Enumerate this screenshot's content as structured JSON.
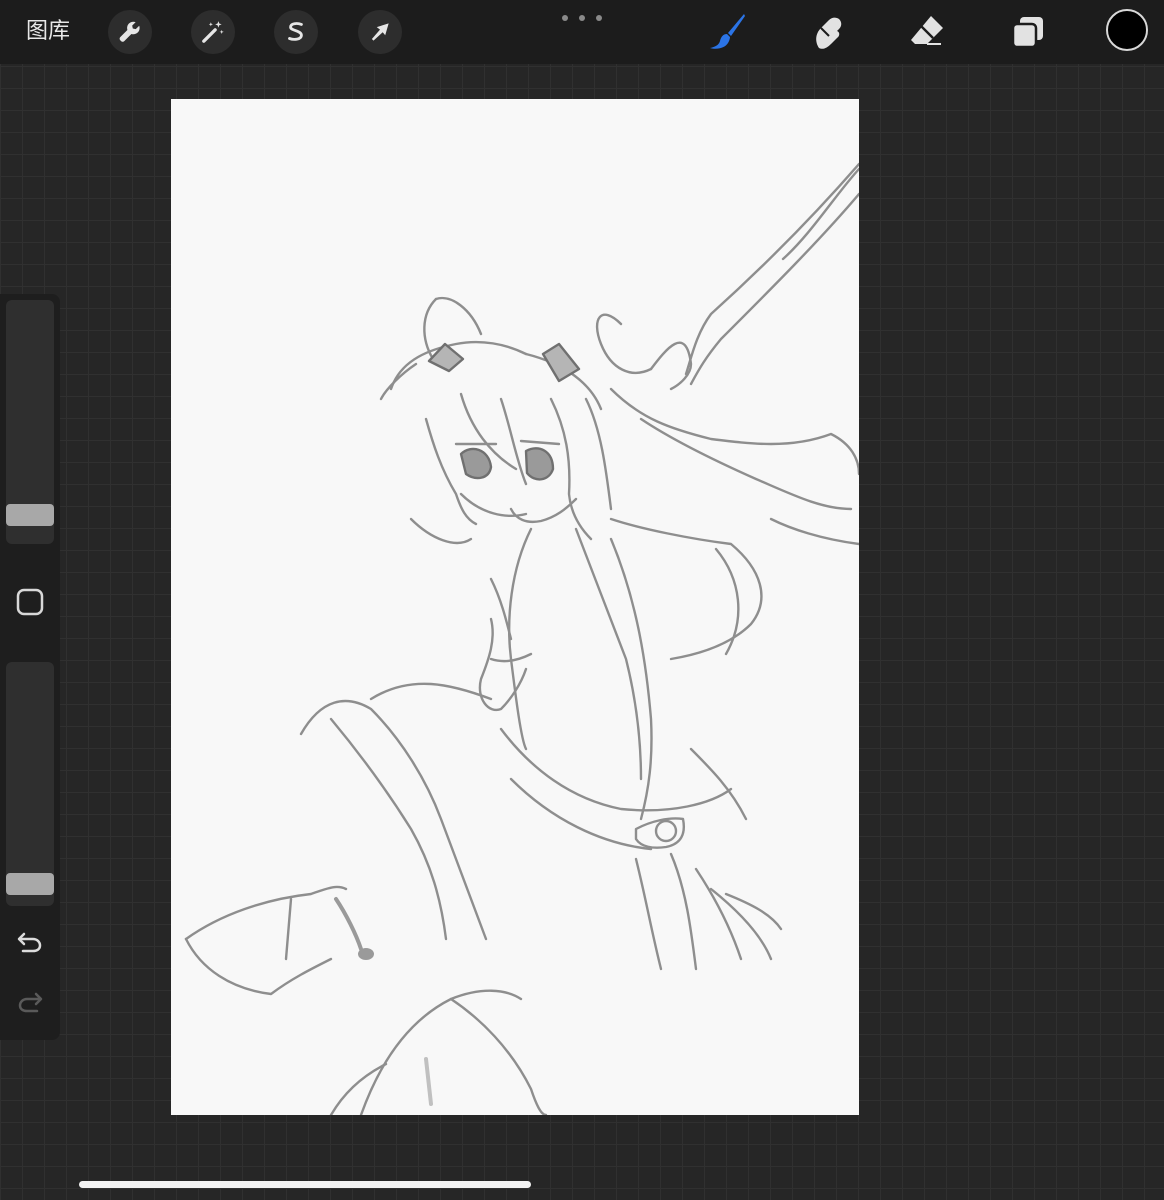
{
  "topbar": {
    "gallery_label": "图库",
    "left_tools": [
      {
        "name": "actions",
        "icon": "wrench-icon"
      },
      {
        "name": "adjustments",
        "icon": "magic-wand-icon"
      },
      {
        "name": "selection",
        "icon": "selection-s-icon"
      },
      {
        "name": "transform",
        "icon": "arrow-cursor-icon"
      }
    ],
    "right_tools": [
      {
        "name": "brush",
        "icon": "brush-icon",
        "active": true
      },
      {
        "name": "smudge",
        "icon": "smudge-icon",
        "active": false
      },
      {
        "name": "eraser",
        "icon": "eraser-icon",
        "active": false
      },
      {
        "name": "layers",
        "icon": "layers-icon",
        "active": false
      }
    ]
  },
  "colors": {
    "active_tool": "#2b74e6",
    "inactive_tool": "#e2e2e2",
    "current_color": "#000000"
  },
  "sidebar": {
    "brush_size_level": 0.08,
    "opacity_level": 0.05
  }
}
